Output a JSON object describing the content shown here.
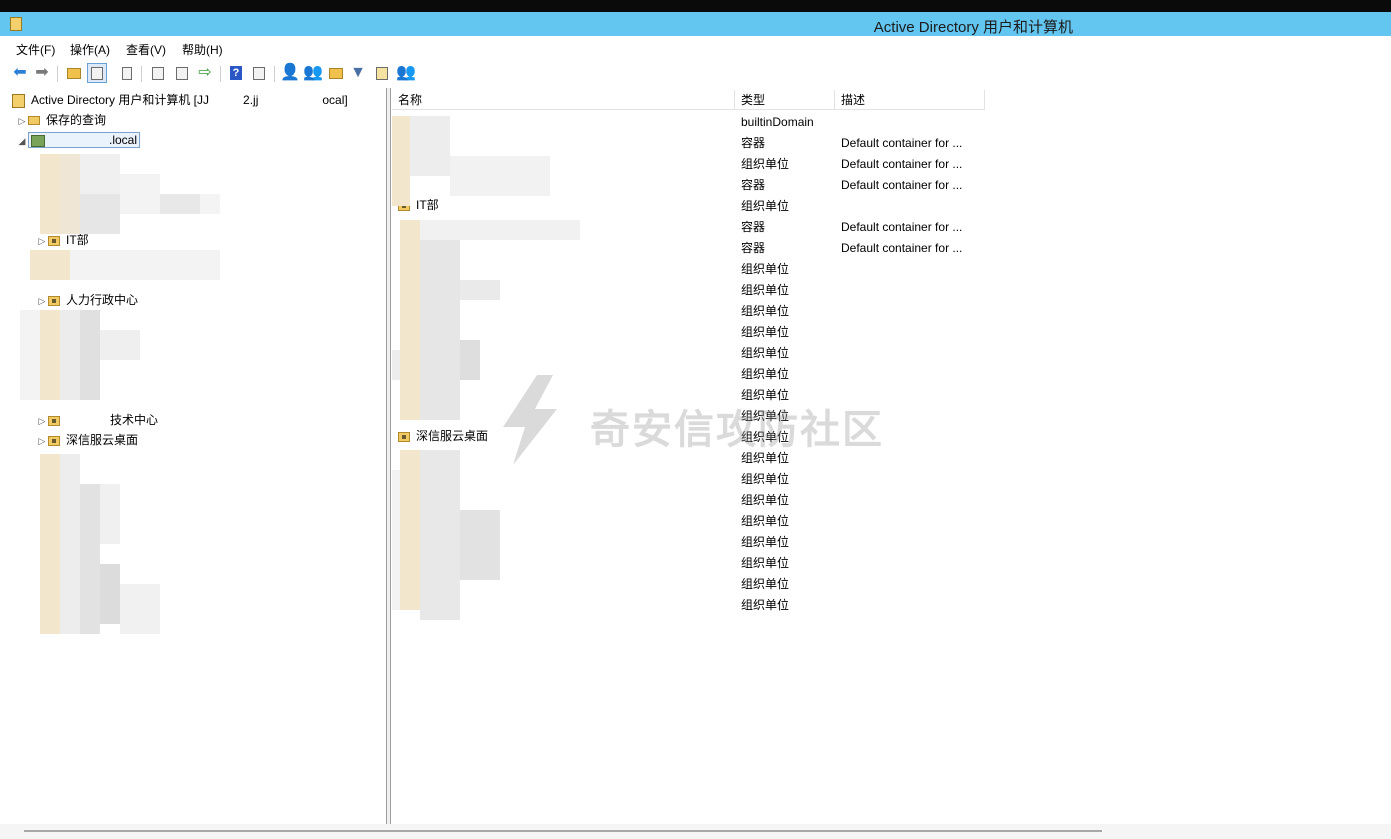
{
  "rdp_bar": {
    "title": ""
  },
  "window": {
    "title": "Active Directory 用户和计算机"
  },
  "menu": [
    {
      "label": "文件(F)"
    },
    {
      "label": "操作(A)"
    },
    {
      "label": "查看(V)"
    },
    {
      "label": "帮助(H)"
    }
  ],
  "tree": {
    "root": "Active Directory 用户和计算机 [JJ",
    "root_fragment_1": "2.jj",
    "root_suffix": "ocal]",
    "saved_queries": "保存的查询",
    "domain_suffix": ".local",
    "ou_it": "IT部",
    "ou_hr": "人力行政中心",
    "ou_tech": "技术中心",
    "ou_cloud": "深信服云桌面"
  },
  "list": {
    "columns": {
      "name": "名称",
      "type": "类型",
      "desc": "描述"
    },
    "visible_names": {
      "it": "IT部",
      "cloud": "深信服云桌面"
    },
    "rows": [
      {
        "type": "builtinDomain",
        "desc": ""
      },
      {
        "type": "容器",
        "desc": "Default container for ..."
      },
      {
        "type": "组织单位",
        "desc": "Default container for ..."
      },
      {
        "type": "容器",
        "desc": "Default container for ..."
      },
      {
        "type": "组织单位",
        "desc": ""
      },
      {
        "type": "容器",
        "desc": "Default container for ..."
      },
      {
        "type": "容器",
        "desc": "Default container for ..."
      },
      {
        "type": "组织单位",
        "desc": ""
      },
      {
        "type": "组织单位",
        "desc": ""
      },
      {
        "type": "组织单位",
        "desc": ""
      },
      {
        "type": "组织单位",
        "desc": ""
      },
      {
        "type": "组织单位",
        "desc": ""
      },
      {
        "type": "组织单位",
        "desc": ""
      },
      {
        "type": "组织单位",
        "desc": ""
      },
      {
        "type": "组织单位",
        "desc": ""
      },
      {
        "type": "组织单位",
        "desc": ""
      },
      {
        "type": "组织单位",
        "desc": ""
      },
      {
        "type": "组织单位",
        "desc": ""
      },
      {
        "type": "组织单位",
        "desc": ""
      },
      {
        "type": "组织单位",
        "desc": ""
      },
      {
        "type": "组织单位",
        "desc": ""
      },
      {
        "type": "组织单位",
        "desc": ""
      },
      {
        "type": "组织单位",
        "desc": ""
      },
      {
        "type": "组织单位",
        "desc": ""
      }
    ]
  },
  "watermark": {
    "text": "奇安信攻防社区"
  },
  "colors": {
    "title_bar": "#63c6f0",
    "folder": "#f1ca63",
    "selection": "#eaf2fb"
  }
}
